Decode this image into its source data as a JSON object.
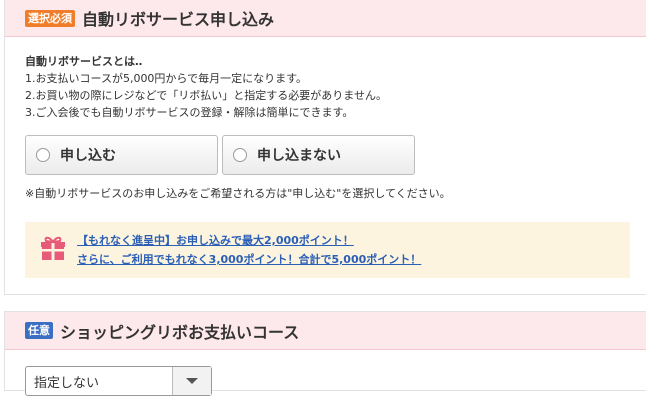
{
  "section1": {
    "badge": "選択必須",
    "badge_color": "#f07d2a",
    "title": "自動リボサービス申し込み",
    "desc_title": "自動リボサービスとは‥",
    "desc_lines": [
      "1.お支払いコースが5,000円からで毎月一定になります。",
      "2.お買い物の際にレジなどで「リボ払い」と指定する必要がありません。",
      "3.ご入会後でも自動リボサービスの登録・解除は簡単にできます。"
    ],
    "options": [
      "申し込む",
      "申し込まない"
    ],
    "note": "※自動リボサービスのお申し込みをご希望される方は\"申し込む\"を選択してください。",
    "promo_icon": "gift-icon",
    "promo_lines": [
      "【もれなく進呈中】お申し込みで最大2,000ポイント！",
      "さらに、ご利用でもれなく3,000ポイント！合計で5,000ポイント！"
    ],
    "link_color": "#2a5fb5"
  },
  "section2": {
    "badge": "任意",
    "badge_color": "#3a6fc4",
    "title": "ショッピングリボお支払いコース",
    "select_value": "指定しない",
    "select_icon": "chevron-down-icon"
  }
}
